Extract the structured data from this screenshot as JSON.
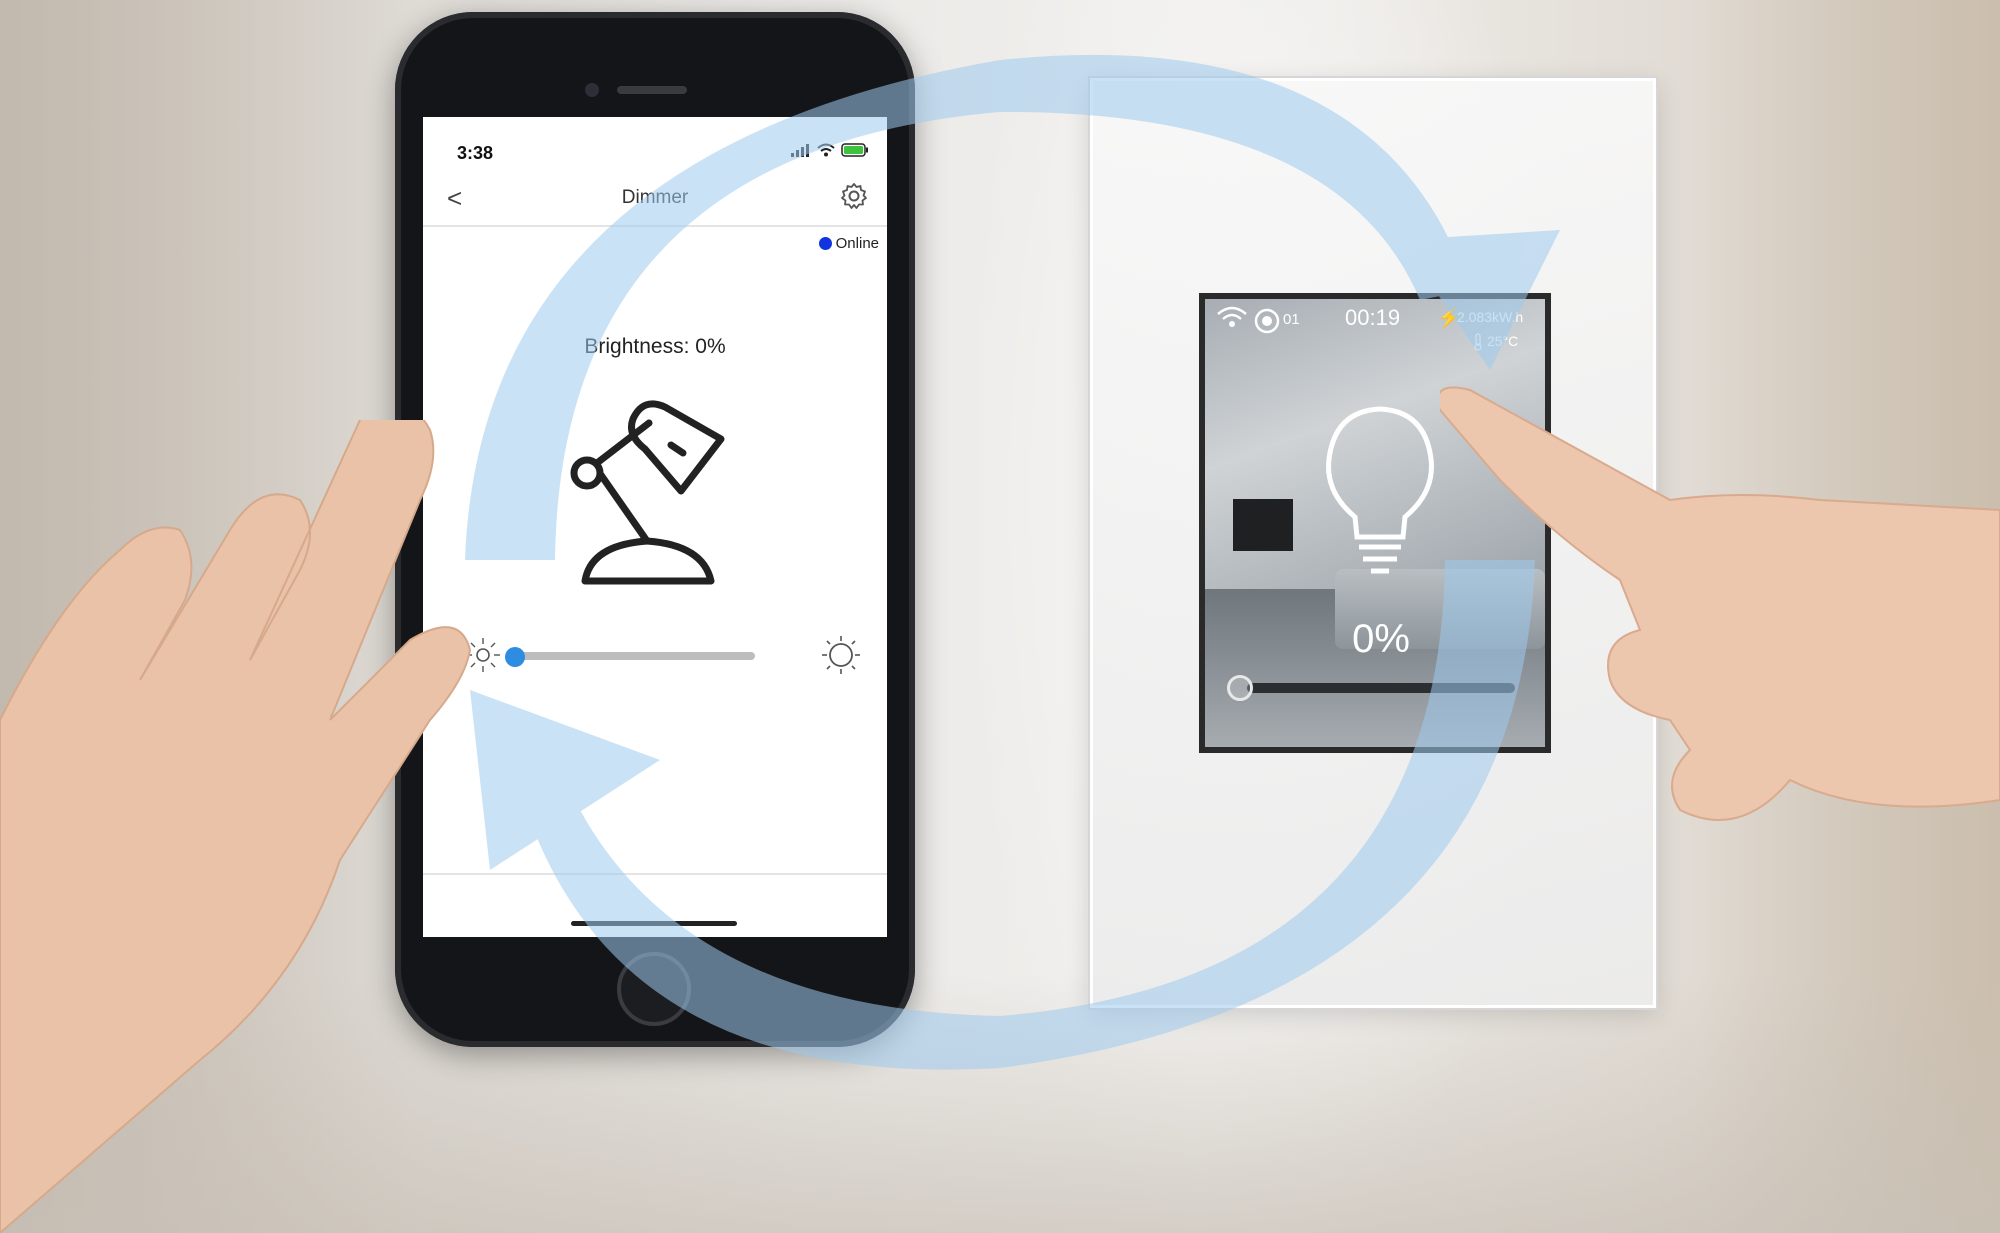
{
  "phone": {
    "status_time": "3:38",
    "nav_back_glyph": "<",
    "nav_title": "Dimmer",
    "online_label": "Online",
    "brightness_label": "Brightness: 0%",
    "slider": {
      "value_percent": 0
    },
    "icons": [
      "signal-icon",
      "wifi-icon",
      "battery-icon",
      "back-chevron-icon",
      "gear-icon",
      "desk-lamp-icon",
      "sun-dim-icon",
      "sun-bright-icon"
    ]
  },
  "wall_switch": {
    "channel": "01",
    "time": "00:19",
    "energy": "2.083kW.h",
    "temperature": "25°C",
    "brightness_percent": "0%",
    "slider": {
      "value_percent": 0
    },
    "icons": [
      "wifi-icon",
      "ring-icon",
      "bolt-icon",
      "thermometer-icon",
      "bulb-icon"
    ]
  },
  "colors": {
    "online_dot": "#1034e0",
    "slider_thumb": "#2e8de0",
    "sync_arrow": "#9ecbee"
  }
}
